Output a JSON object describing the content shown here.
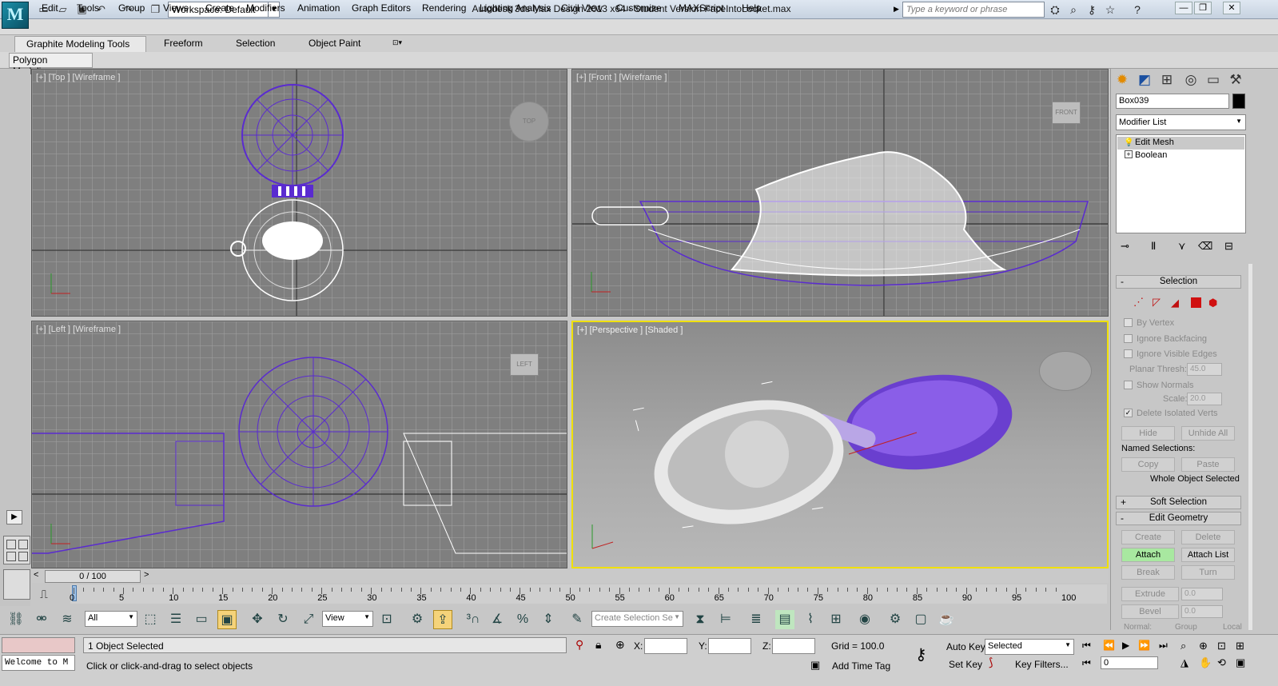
{
  "title_bar": {
    "workspace": "Workspace: Default",
    "title": "Autodesk 3ds Max Design 2013 x64   -  Student Version     FaceIntoLocket.max",
    "search_placeholder": "Type a keyword or phrase",
    "logo_label": "3DS"
  },
  "menu": [
    "Edit",
    "Tools",
    "Group",
    "Views",
    "Create",
    "Modifiers",
    "Animation",
    "Graph Editors",
    "Rendering",
    "Lighting Analysis",
    "Civil View",
    "Customize",
    "MAXScript",
    "Help"
  ],
  "ribbon": {
    "tabs": [
      "Graphite Modeling Tools",
      "Freeform",
      "Selection",
      "Object Paint"
    ],
    "panel": "Polygon Modeling"
  },
  "viewports": {
    "top": {
      "label": "[+] [Top ] [Wireframe ]",
      "cube": "TOP"
    },
    "front": {
      "label": "[+] [Front ] [Wireframe ]",
      "cube": "FRONT"
    },
    "left": {
      "label": "[+] [Left ] [Wireframe ]",
      "cube": "LEFT"
    },
    "persp": {
      "label": "[+] [Perspective ] [Shaded ]"
    }
  },
  "command_panel": {
    "object_name": "Box039",
    "modifier_list": "Modifier List",
    "stack": [
      "Edit Mesh",
      "Boolean"
    ],
    "selection": {
      "header": "Selection",
      "by_vertex": "By Vertex",
      "ignore_backfacing": "Ignore Backfacing",
      "ignore_visible_edges": "Ignore Visible Edges",
      "planar_thresh_label": "Planar Thresh:",
      "planar_thresh": "45.0",
      "show_normals": "Show Normals",
      "scale_label": "Scale:",
      "scale": "20.0",
      "delete_isolated": "Delete Isolated Verts",
      "hide": "Hide",
      "unhide_all": "Unhide All",
      "named_selections": "Named Selections:",
      "copy": "Copy",
      "paste": "Paste",
      "whole_object": "Whole Object Selected"
    },
    "soft_selection": "Soft Selection",
    "edit_geometry": {
      "header": "Edit Geometry",
      "create": "Create",
      "delete": "Delete",
      "attach": "Attach",
      "attach_list": "Attach List",
      "break": "Break",
      "turn": "Turn",
      "extrude": "Extrude",
      "extrude_val": "0.0",
      "bevel": "Bevel",
      "bevel_val": "0.0",
      "normal": "Normal:",
      "group": "Group",
      "local": "Local"
    }
  },
  "timeline": {
    "slider": "0 / 100",
    "ticks": [
      "0",
      "5",
      "10",
      "15",
      "20",
      "25",
      "30",
      "35",
      "40",
      "45",
      "50",
      "55",
      "60",
      "65",
      "70",
      "75",
      "80",
      "85",
      "90",
      "95",
      "100"
    ]
  },
  "toolbar": {
    "filter": "All",
    "ref_coord": "View",
    "selection_set": "Create Selection Se"
  },
  "status": {
    "selected": "1 Object Selected",
    "prompt": "Click or click-and-drag to select objects",
    "maxscript": "Welcome to M",
    "x": "X:",
    "y": "Y:",
    "z": "Z:",
    "grid": "Grid = 100.0",
    "add_time_tag": "Add Time Tag",
    "auto_key": "Auto Key",
    "set_key": "Set Key",
    "key_mode": "Selected",
    "key_filters": "Key Filters...",
    "frame": "0"
  },
  "colors": {
    "selection_purple": "#5a2bd0",
    "active_viewport": "#f0e000"
  }
}
